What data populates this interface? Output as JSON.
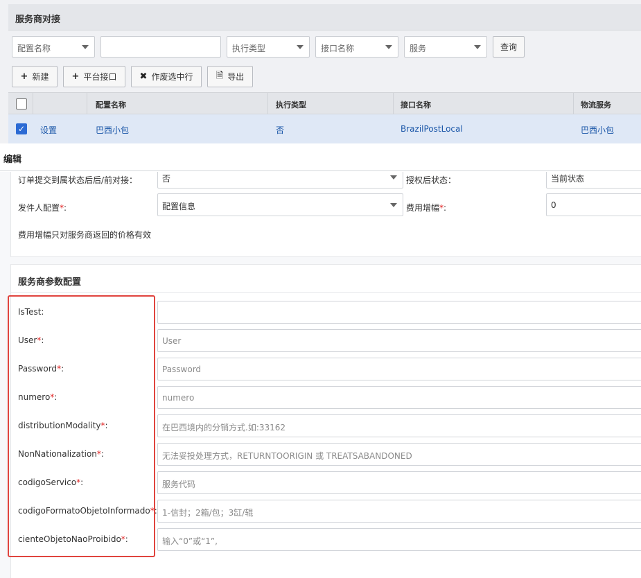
{
  "background": {
    "title": "服务商对接",
    "filters": [
      {
        "label": "配置名称",
        "dropdown": true
      },
      {
        "label": "",
        "dropdown": false
      },
      {
        "label": "执行类型",
        "dropdown": true
      },
      {
        "label": "接口名称",
        "dropdown": true
      },
      {
        "label": "服务",
        "dropdown": true
      }
    ],
    "query_label": "查询",
    "toolbar": {
      "new_label": "新建",
      "platform_label": "平台接口",
      "void_label": "作废选中行",
      "export_label": "导出"
    },
    "grid": {
      "headers": [
        "配置名称",
        "执行类型",
        "接口名称",
        "物流服务"
      ],
      "row": {
        "action": "设置",
        "name": "巴西小包",
        "exec_type": "否",
        "interface": "BrazilPostLocal",
        "service": "巴西小包"
      }
    }
  },
  "modal": {
    "title": "编辑",
    "cut_row": {
      "label_left": "订单提交到属状态后后/前对接：",
      "value_left": "否",
      "label_right": "授权后状态：",
      "value_right": "当前状态"
    },
    "sender": {
      "label": "发件人配置",
      "value": "配置信息"
    },
    "fee": {
      "label": "费用增幅",
      "value": "0"
    },
    "fee_note": "费用增幅只对服务商返回的价格有效",
    "params_title": "服务商参数配置",
    "params": [
      {
        "label": "IsTest",
        "required": false,
        "value": "",
        "placeholder": ""
      },
      {
        "label": "User",
        "required": true,
        "value": "",
        "placeholder": "User"
      },
      {
        "label": "Password",
        "required": true,
        "value": "",
        "placeholder": "Password"
      },
      {
        "label": "numero",
        "required": true,
        "value": "",
        "placeholder": "numero"
      },
      {
        "label": "distributionModality",
        "required": true,
        "value": "",
        "placeholder": "在巴西境内的分销方式.如:33162"
      },
      {
        "label": "NonNationalization",
        "required": true,
        "value": "",
        "placeholder": "无法妥投处理方式，RETURNTOORIGIN 或 TREATSABANDONED"
      },
      {
        "label": "codigoServico",
        "required": true,
        "value": "",
        "placeholder": "服务代码"
      },
      {
        "label": "codigoFormatoObjetoInformado",
        "required": true,
        "value": "",
        "placeholder": "1-信封；2箱/包；3缸/辊"
      },
      {
        "label": "cienteObjetoNaoProibido",
        "required": true,
        "value": "",
        "placeholder": "输入“0”或“1”,"
      }
    ],
    "required_mark": "*",
    "colon": ":",
    "highlight_color": "#e0443e"
  }
}
